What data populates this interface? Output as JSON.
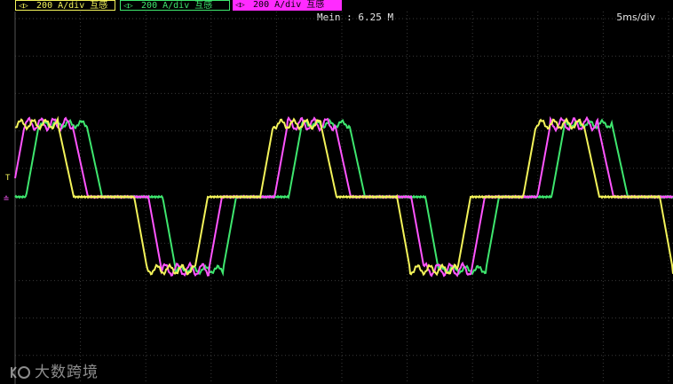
{
  "channels": [
    {
      "label": "200 A/div 互感",
      "color": "#f3f35a"
    },
    {
      "label": "200 A/div 互感",
      "color": "#3ee66e"
    },
    {
      "label": "200 A/div 互感",
      "color": "#ff2bff"
    }
  ],
  "memory_rate": "Mein : 6.25 M",
  "timebase": "5ms/div",
  "markers": {
    "trigger": "T",
    "reference": "≐"
  },
  "grid_color": "#3a3a3a",
  "watermark": "大数跨境",
  "waveform_colors": {
    "yellow": "#f3f35a",
    "green": "#3ee66e",
    "magenta": "#ff55ff"
  }
}
